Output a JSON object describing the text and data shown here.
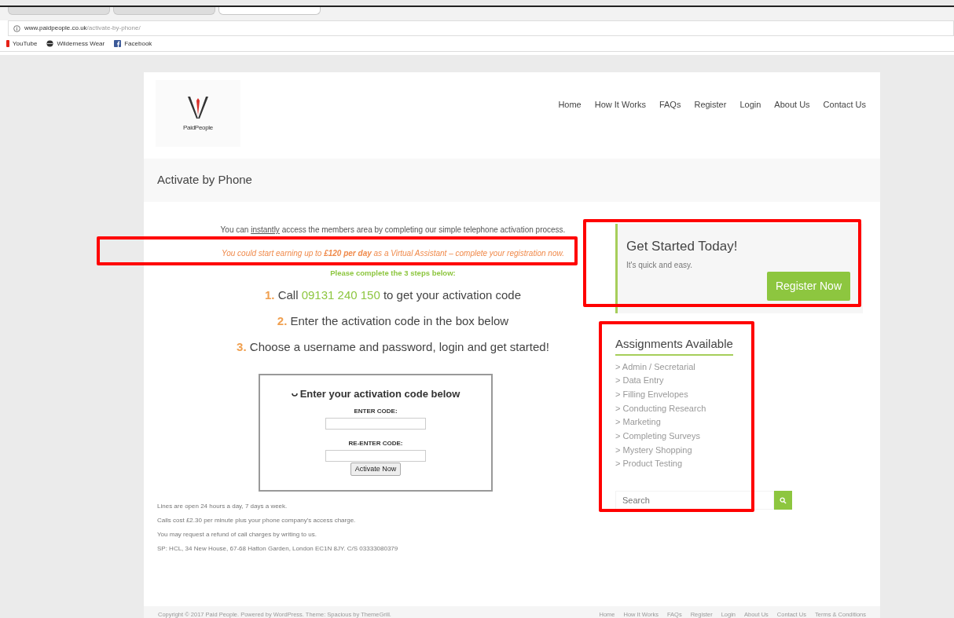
{
  "browser": {
    "tabs": [
      {
        "selected": false
      },
      {
        "selected": false
      },
      {
        "selected": true
      }
    ],
    "url_host": "www.paidpeople.co.uk",
    "url_path": "/activate-by-phone/",
    "bookmarks": [
      {
        "label": "YouTube",
        "kind": "video"
      },
      {
        "label": "Wilderness Wear",
        "kind": "globe"
      },
      {
        "label": "Facebook",
        "kind": "social"
      }
    ]
  },
  "header": {
    "logo_text": "PaidPeople",
    "nav": [
      "Home",
      "How It Works",
      "FAQs",
      "Register",
      "Login",
      "About Us",
      "Contact Us"
    ]
  },
  "page_title": "Activate by Phone",
  "intro": {
    "before": "You can ",
    "link": "instantly",
    "after": " access the members area by completing our simple telephone activation process."
  },
  "promo": "You could start earning up to **£120 per day** as a Virtual Assistant – complete your registration now.",
  "steps_heading": "Please complete the 3 steps below:",
  "steps": [
    {
      "number": "1.",
      "text": "Call ",
      "phone": "09131 240 150",
      "rest": " to get your activation code"
    },
    {
      "number": "2.",
      "text": "Enter the activation code in the box below"
    },
    {
      "number": "3.",
      "text": "Choose a username and password, login and get started!"
    }
  ],
  "activation_box": {
    "title": "Enter your activation code below",
    "fields": [
      {
        "label": "ENTER CODE:"
      },
      {
        "label": "RE-ENTER CODE:"
      }
    ],
    "button": "Activate Now"
  },
  "notes": [
    "Lines are open 24 hours a day, 7 days a week.",
    "Calls cost £2.30 per minute plus your phone company's access charge.",
    "You may request a refund of call charges by writing to us.",
    "SP: HCL, 34 New House, 67-68 Hatton Garden, London EC1N 8JY. C/S 03333080379"
  ],
  "cta": {
    "title": "Get Started Today!",
    "subtitle": "It's quick and easy.",
    "button": "Register Now"
  },
  "assignments": {
    "title": "Assignments Available",
    "items": [
      "> Admin / Secretarial",
      "> Data Entry",
      "> Filling Envelopes",
      "> Conducting Research",
      "> Marketing",
      "> Completing Surveys",
      "> Mystery Shopping",
      "> Product Testing"
    ]
  },
  "search": {
    "placeholder": "Search"
  },
  "footer": {
    "copyright": "Copyright © 2017 Paid People. Powered by WordPress. Theme: Spacious by ThemeGrill.",
    "links": [
      "Home",
      "How It Works",
      "FAQs",
      "Register",
      "Login",
      "About Us",
      "Contact Us",
      "Terms & Conditions"
    ]
  },
  "annotations": [
    {
      "kind": "rectangle"
    },
    {
      "kind": "rectangle"
    },
    {
      "kind": "rectangle"
    }
  ]
}
